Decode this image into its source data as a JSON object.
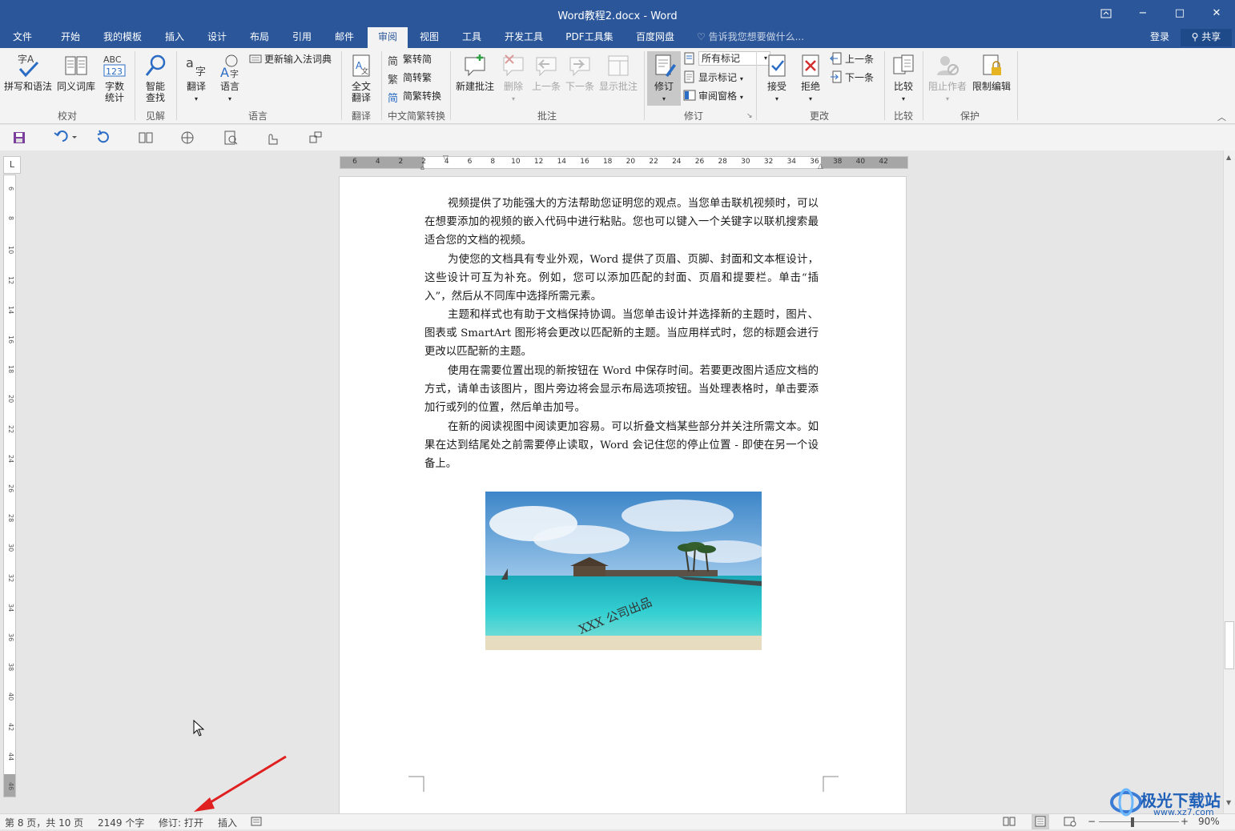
{
  "window": {
    "title": "Word教程2.docx - Word",
    "restore_icon": "ribbon-display-options-icon",
    "minimize": "−",
    "maximize": "□",
    "close": "✕"
  },
  "tabs": [
    {
      "label": "文件",
      "active": false
    },
    {
      "label": "开始",
      "active": false
    },
    {
      "label": "我的模板",
      "active": false
    },
    {
      "label": "插入",
      "active": false
    },
    {
      "label": "设计",
      "active": false
    },
    {
      "label": "布局",
      "active": false
    },
    {
      "label": "引用",
      "active": false
    },
    {
      "label": "邮件",
      "active": false
    },
    {
      "label": "审阅",
      "active": true
    },
    {
      "label": "视图",
      "active": false
    },
    {
      "label": "工具",
      "active": false
    },
    {
      "label": "开发工具",
      "active": false
    },
    {
      "label": "PDF工具集",
      "active": false
    },
    {
      "label": "百度网盘",
      "active": false
    }
  ],
  "tell_me": "告诉我您想要做什么...",
  "account": {
    "login": "登录",
    "share": "共享"
  },
  "ribbon": {
    "proofing": {
      "group": "校对",
      "spelling": "拼写和语法",
      "thesaurus": "同义词库",
      "wordcount_l1": "字数",
      "wordcount_l2": "统计"
    },
    "insights": {
      "group": "见解",
      "smart_l1": "智能",
      "smart_l2": "查找"
    },
    "language": {
      "group": "语言",
      "translate": "翻译",
      "language": "语言",
      "update_ime": "更新输入法词典"
    },
    "translation": {
      "group": "翻译",
      "full_l1": "全文",
      "full_l2": "翻译"
    },
    "chinese_conversion": {
      "group": "中文简繁转换",
      "to_simplified": "繁转简",
      "to_traditional": "简转繁",
      "convert": "简繁转换"
    },
    "comments": {
      "group": "批注",
      "new": "新建批注",
      "delete": "删除",
      "previous": "上一条",
      "next": "下一条",
      "show": "显示批注"
    },
    "tracking": {
      "group": "修订",
      "track": "修订",
      "markup_select": "所有标记",
      "show_markup": "显示标记",
      "review_pane": "审阅窗格"
    },
    "changes": {
      "group": "更改",
      "accept": "接受",
      "reject": "拒绝",
      "previous": "上一条",
      "next": "下一条"
    },
    "compare": {
      "group": "比较",
      "compare": "比较"
    },
    "protect": {
      "group": "保护",
      "block_authors": "阻止作者",
      "restrict": "限制编辑"
    }
  },
  "ruler": {
    "h_ticks": [
      "6",
      "4",
      "2",
      "2",
      "4",
      "6",
      "8",
      "10",
      "12",
      "14",
      "16",
      "18",
      "20",
      "22",
      "24",
      "26",
      "28",
      "30",
      "32",
      "34",
      "36",
      "38",
      "40",
      "42"
    ],
    "v_ticks": [
      "6",
      "8",
      "10",
      "12",
      "14",
      "16",
      "18",
      "20",
      "22",
      "24",
      "26",
      "28",
      "30",
      "32",
      "34",
      "36",
      "38",
      "40",
      "42",
      "44",
      "46"
    ]
  },
  "document": {
    "paragraphs": [
      "视频提供了功能强大的方法帮助您证明您的观点。当您单击联机视频时，可以在想要添加的视频的嵌入代码中进行粘贴。您也可以键入一个关键字以联机搜索最适合您的文档的视频。",
      "为使您的文档具有专业外观，Word 提供了页眉、页脚、封面和文本框设计，这些设计可互为补充。例如，您可以添加匹配的封面、页眉和提要栏。单击“插入”，然后从不同库中选择所需元素。",
      "主题和样式也有助于文档保持协调。当您单击设计并选择新的主题时，图片、图表或 SmartArt 图形将会更改以匹配新的主题。当应用样式时，您的标题会进行更改以匹配新的主题。",
      "使用在需要位置出现的新按钮在 Word 中保存时间。若要更改图片适应文档的方式，请单击该图片，图片旁边将会显示布局选项按钮。当处理表格时，单击要添加行或列的位置，然后单击加号。",
      "在新的阅读视图中阅读更加容易。可以折叠文档某些部分并关注所需文本。如果在达到结尾处之前需要停止读取，Word 会记住您的停止位置 - 即使在另一个设备上。"
    ],
    "image_watermark": "XXX 公司出品"
  },
  "status": {
    "page": "第 8 页，共 10 页",
    "words": "2149 个字",
    "track_changes": "修订: 打开",
    "mode": "插入",
    "zoom": "90%"
  },
  "overlay_watermark": "极光下载站",
  "overlay_watermark_url": "www.xz7.com",
  "colors": {
    "brand": "#2b579a",
    "ribbon": "#f3f3f3",
    "arrow": "#e02020"
  }
}
